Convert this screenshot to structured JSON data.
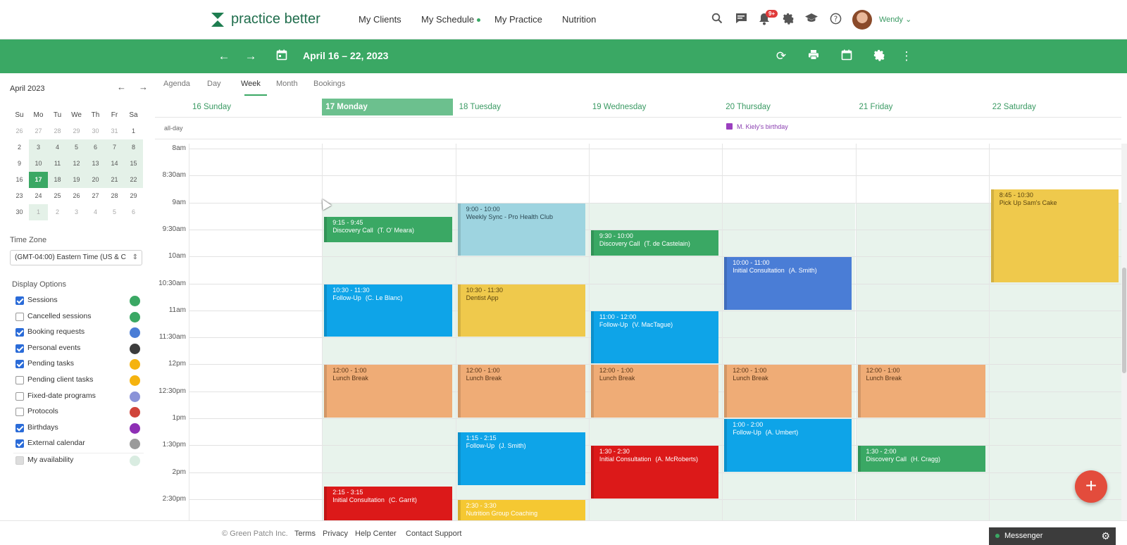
{
  "app": {
    "brand": "practice better"
  },
  "nav": {
    "clients": "My Clients",
    "schedule": "My Schedule",
    "practice": "My Practice",
    "nutrition": "Nutrition"
  },
  "header": {
    "notif_badge": "9+",
    "user_name": "Wendy"
  },
  "toolbar": {
    "date_range": "April 16 – 22, 2023"
  },
  "mini_calendar": {
    "title": "April 2023",
    "weekdays": [
      "Su",
      "Mo",
      "Tu",
      "We",
      "Th",
      "Fr",
      "Sa"
    ],
    "weeks": [
      [
        "26",
        "27",
        "28",
        "29",
        "30",
        "31",
        "1"
      ],
      [
        "2",
        "3",
        "4",
        "5",
        "6",
        "7",
        "8"
      ],
      [
        "9",
        "10",
        "11",
        "12",
        "13",
        "14",
        "15"
      ],
      [
        "16",
        "17",
        "18",
        "19",
        "20",
        "21",
        "22"
      ],
      [
        "23",
        "24",
        "25",
        "26",
        "27",
        "28",
        "29"
      ],
      [
        "30",
        "1",
        "2",
        "3",
        "4",
        "5",
        "6"
      ]
    ],
    "today": "17"
  },
  "timezone": {
    "label": "Time Zone",
    "value": "(GMT-04:00) Eastern Time (US & C"
  },
  "display_options": {
    "label": "Display Options",
    "items": [
      {
        "label": "Sessions",
        "checked": true,
        "color": "#3aa864"
      },
      {
        "label": "Cancelled sessions",
        "checked": false,
        "color": "#3aa864"
      },
      {
        "label": "Booking requests",
        "checked": true,
        "color": "#4a7dd6"
      },
      {
        "label": "Personal events",
        "checked": true,
        "color": "#3c3c3c"
      },
      {
        "label": "Pending tasks",
        "checked": true,
        "color": "#f5b30f"
      },
      {
        "label": "Pending client tasks",
        "checked": false,
        "color": "#f5b30f"
      },
      {
        "label": "Fixed-date programs",
        "checked": false,
        "color": "#8a93d8"
      },
      {
        "label": "Protocols",
        "checked": false,
        "color": "#d0443a"
      },
      {
        "label": "Birthdays",
        "checked": true,
        "color": "#8e2fb5"
      },
      {
        "label": "External calendar",
        "checked": true,
        "color": "#9a9a9a"
      },
      {
        "label": "My availability",
        "checked": false,
        "color": "#d9ece1"
      }
    ]
  },
  "views": [
    "Agenda",
    "Day",
    "Week",
    "Month",
    "Bookings"
  ],
  "active_view": "Week",
  "days": [
    "16 Sunday",
    "17 Monday",
    "18 Tuesday",
    "19 Wednesday",
    "20 Thursday",
    "21 Friday",
    "22 Saturday"
  ],
  "today_index": 1,
  "allday": {
    "label": "all-day",
    "birthday": "M. Kiely's birthday"
  },
  "time_labels": [
    "8am",
    "8:30am",
    "9am",
    "9:30am",
    "10am",
    "10:30am",
    "11am",
    "11:30am",
    "12pm",
    "12:30pm",
    "1pm",
    "1:30pm",
    "2pm",
    "2:30pm"
  ],
  "events": [
    {
      "day": 1,
      "start": 9.25,
      "end": 9.75,
      "time": "9:15 - 9:45",
      "title": "Discovery Call",
      "who": "(T. O' Meara)",
      "color": "green"
    },
    {
      "day": 1,
      "start": 10.5,
      "end": 11.5,
      "time": "10:30 - 11:30",
      "title": "Follow-Up",
      "who": "(C. Le Blanc)",
      "color": "blue"
    },
    {
      "day": 1,
      "start": 12,
      "end": 13,
      "time": "12:00 - 1:00",
      "title": "Lunch Break",
      "who": "",
      "color": "orange"
    },
    {
      "day": 1,
      "start": 14.25,
      "end": 15.25,
      "time": "2:15 - 3:15",
      "title": "Initial Consultation",
      "who": "(C. Garrit)",
      "color": "red"
    },
    {
      "day": 2,
      "start": 9,
      "end": 10,
      "time": "9:00 - 10:00",
      "title": "Weekly Sync - Pro Health Club",
      "who": "",
      "color": "teal"
    },
    {
      "day": 2,
      "start": 10.5,
      "end": 11.5,
      "time": "10:30 - 11:30",
      "title": "Dentist App",
      "who": "",
      "color": "yellow"
    },
    {
      "day": 2,
      "start": 12,
      "end": 13,
      "time": "12:00 - 1:00",
      "title": "Lunch Break",
      "who": "",
      "color": "orange"
    },
    {
      "day": 2,
      "start": 13.25,
      "end": 14.25,
      "time": "1:15 - 2:15",
      "title": "Follow-Up",
      "who": "(J. Smith)",
      "color": "blue"
    },
    {
      "day": 2,
      "start": 14.5,
      "end": 15.5,
      "time": "2:30 - 3:30",
      "title": "Nutrition Group Coaching",
      "who": "",
      "color": "gold"
    },
    {
      "day": 3,
      "start": 9.5,
      "end": 10,
      "time": "9:30 - 10:00",
      "title": "Discovery Call",
      "who": "(T. de Castelain)",
      "color": "green"
    },
    {
      "day": 3,
      "start": 11,
      "end": 12,
      "time": "11:00 - 12:00",
      "title": "Follow-Up",
      "who": "(V. MacTague)",
      "color": "blue"
    },
    {
      "day": 3,
      "start": 12,
      "end": 13,
      "time": "12:00 - 1:00",
      "title": "Lunch Break",
      "who": "",
      "color": "orange"
    },
    {
      "day": 3,
      "start": 13.5,
      "end": 14.5,
      "time": "1:30 - 2:30",
      "title": "Initial Consultation",
      "who": "(A. McRoberts)",
      "color": "red"
    },
    {
      "day": 4,
      "start": 10,
      "end": 11,
      "time": "10:00 - 11:00",
      "title": "Initial Consultation",
      "who": "(A. Smith)",
      "color": "navy"
    },
    {
      "day": 4,
      "start": 12,
      "end": 13,
      "time": "12:00 - 1:00",
      "title": "Lunch Break",
      "who": "",
      "color": "orange"
    },
    {
      "day": 4,
      "start": 13,
      "end": 14,
      "time": "1:00 - 2:00",
      "title": "Follow-Up",
      "who": "(A. Umbert)",
      "color": "blue"
    },
    {
      "day": 5,
      "start": 12,
      "end": 13,
      "time": "12:00 - 1:00",
      "title": "Lunch Break",
      "who": "",
      "color": "orange"
    },
    {
      "day": 5,
      "start": 13.5,
      "end": 14,
      "time": "1:30 - 2:00",
      "title": "Discovery Call",
      "who": "(H. Cragg)",
      "color": "green"
    },
    {
      "day": 6,
      "start": 8.75,
      "end": 10.5,
      "time": "8:45 - 10:30",
      "title": "Pick Up Sam's Cake",
      "who": "",
      "color": "yellow"
    }
  ],
  "footer": {
    "copyright": "© Green Patch Inc.",
    "terms": "Terms",
    "privacy": "Privacy",
    "help": "Help Center",
    "support": "Contact Support"
  },
  "messenger": {
    "label": "Messenger"
  }
}
